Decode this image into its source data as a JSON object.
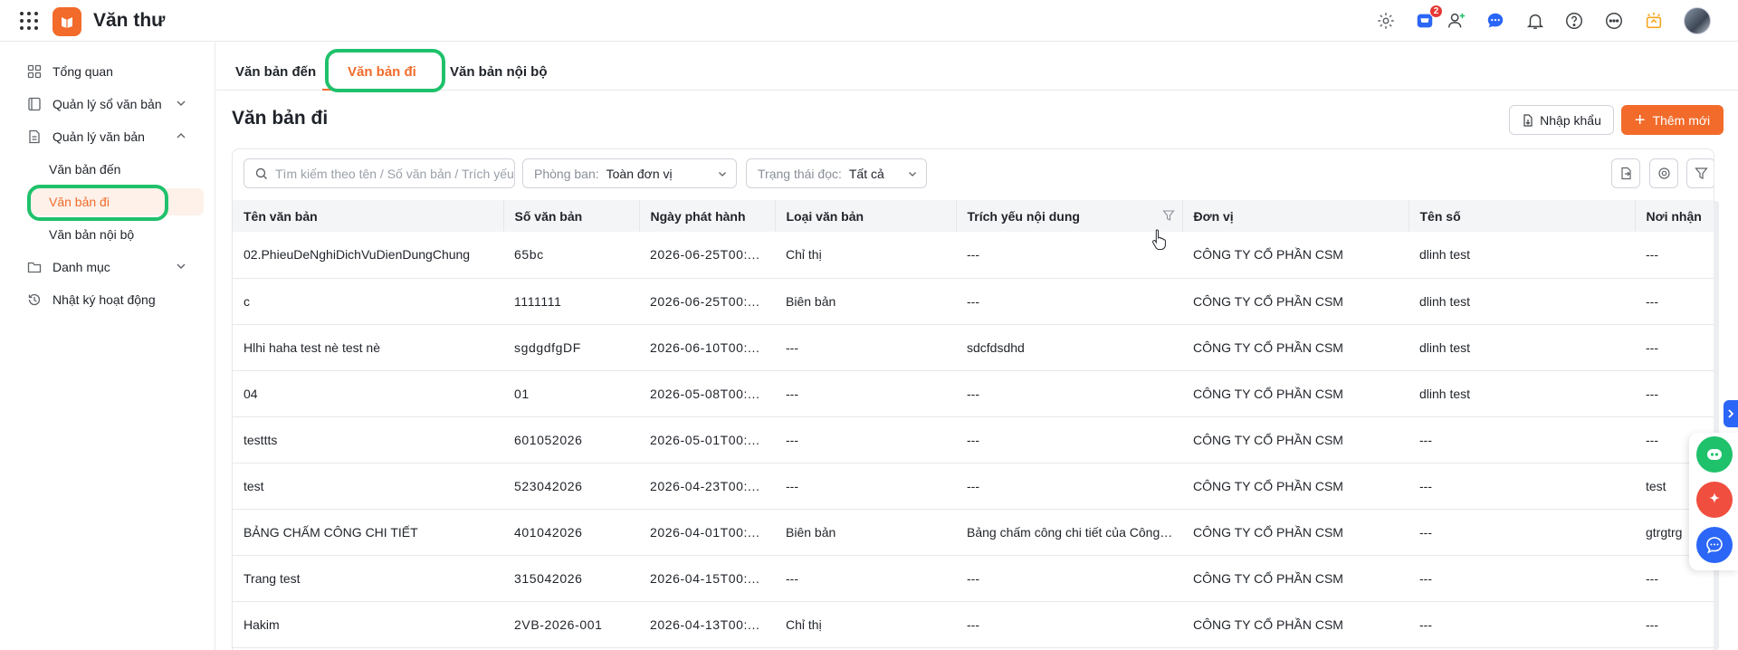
{
  "app": {
    "title": "Văn thư"
  },
  "topbar": {
    "cart_badge": "2"
  },
  "sidebar": {
    "items": [
      {
        "label": "Tổng quan"
      },
      {
        "label": "Quản lý sổ văn bản"
      },
      {
        "label": "Quản lý văn bản"
      },
      {
        "label": "Văn bản đến"
      },
      {
        "label": "Văn bản đi"
      },
      {
        "label": "Văn bản nội bộ"
      },
      {
        "label": "Danh mục"
      },
      {
        "label": "Nhật ký hoạt động"
      }
    ]
  },
  "tabs": [
    {
      "label": "Văn bản đến"
    },
    {
      "label": "Văn bản đi"
    },
    {
      "label": "Văn bản nội bộ"
    }
  ],
  "page": {
    "title": "Văn bản đi",
    "import_label": "Nhập khẩu",
    "add_label": "Thêm mới"
  },
  "filters": {
    "search_placeholder": "Tìm kiếm theo tên / Số văn bản / Trích yếu",
    "department_label": "Phòng ban:",
    "department_value": "Toàn đơn vị",
    "read_status_label": "Trạng thái đọc:",
    "read_status_value": "Tất cả"
  },
  "table": {
    "columns": [
      "Tên văn bản",
      "Số văn bản",
      "Ngày phát hành",
      "Loại văn bản",
      "Trích yếu nội dung",
      "Đơn vị",
      "Tên số",
      "Nơi nhận"
    ],
    "rows": [
      [
        "02.PhieuDeNghiDichVuDienDungChung",
        "65bc",
        "2026-06-25T00:...",
        "Chỉ thị",
        "---",
        "CÔNG TY CỔ PHẦN CSM",
        "dlinh test",
        "---"
      ],
      [
        "c",
        "1111111",
        "2026-06-25T00:...",
        "Biên bản",
        "---",
        "CÔNG TY CỔ PHẦN CSM",
        "dlinh test",
        "---"
      ],
      [
        "Hlhi haha test nè test nè",
        "sgdgdfgDF",
        "2026-06-10T00:...",
        "---",
        "sdcfdsdhd",
        "CÔNG TY CỔ PHẦN CSM",
        "dlinh test",
        "---"
      ],
      [
        "04",
        "01",
        "2026-05-08T00:...",
        "---",
        "---",
        "CÔNG TY CỔ PHẦN CSM",
        "dlinh test",
        "---"
      ],
      [
        "testtts",
        "601052026",
        "2026-05-01T00:...",
        "---",
        "---",
        "CÔNG TY CỔ PHẦN CSM",
        "---",
        "---"
      ],
      [
        "test",
        "523042026",
        "2026-04-23T00:...",
        "---",
        "---",
        "CÔNG TY CỔ PHẦN CSM",
        "---",
        "test"
      ],
      [
        "BẢNG CHẤM CÔNG CHI TIẾT",
        "401042026",
        "2026-04-01T00:...",
        "Biên bản",
        "Bảng chấm công chi tiết của Công ...",
        "CÔNG TY CỔ PHẦN CSM",
        "---",
        "gtrgtrg"
      ],
      [
        "Trang test",
        "315042026",
        "2026-04-15T00:...",
        "---",
        "---",
        "CÔNG TY CỔ PHẦN CSM",
        "---",
        "---"
      ],
      [
        "Hakim",
        "2VB-2026-001",
        "2026-04-13T00:...",
        "Chỉ thị",
        "---",
        "CÔNG TY CỔ PHẦN CSM",
        "---",
        "---"
      ]
    ]
  },
  "colors": {
    "accent": "#f26b2a",
    "highlight": "#1fc16b",
    "header_bg": "#f4f5f7",
    "blue": "#2b66f6"
  }
}
